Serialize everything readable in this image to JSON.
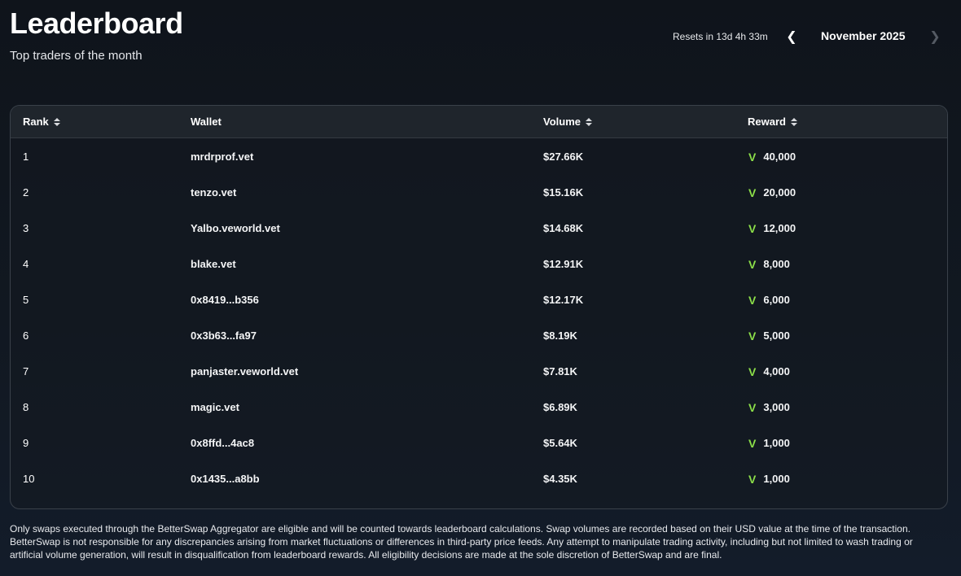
{
  "header": {
    "title": "Leaderboard",
    "subtitle": "Top traders of the month",
    "reset_text": "Resets in 13d 4h 33m",
    "month": "November 2025",
    "prev_icon": "chevron-left-icon",
    "next_icon": "chevron-right-icon"
  },
  "table": {
    "columns": [
      "Rank",
      "Wallet",
      "Volume",
      "Reward"
    ],
    "reward_icon": "vet-token-icon",
    "reward_icon_color": "#8ce049",
    "rows": [
      {
        "rank": "1",
        "wallet": "mrdrprof.vet",
        "volume": "$27.66K",
        "reward": "40,000"
      },
      {
        "rank": "2",
        "wallet": "tenzo.vet",
        "volume": "$15.16K",
        "reward": "20,000"
      },
      {
        "rank": "3",
        "wallet": "Yalbo.veworld.vet",
        "volume": "$14.68K",
        "reward": "12,000"
      },
      {
        "rank": "4",
        "wallet": "blake.vet",
        "volume": "$12.91K",
        "reward": "8,000"
      },
      {
        "rank": "5",
        "wallet": "0x8419...b356",
        "volume": "$12.17K",
        "reward": "6,000"
      },
      {
        "rank": "6",
        "wallet": "0x3b63...fa97",
        "volume": "$8.19K",
        "reward": "5,000"
      },
      {
        "rank": "7",
        "wallet": "panjaster.veworld.vet",
        "volume": "$7.81K",
        "reward": "4,000"
      },
      {
        "rank": "8",
        "wallet": "magic.vet",
        "volume": "$6.89K",
        "reward": "3,000"
      },
      {
        "rank": "9",
        "wallet": "0x8ffd...4ac8",
        "volume": "$5.64K",
        "reward": "1,000"
      },
      {
        "rank": "10",
        "wallet": "0x1435...a8bb",
        "volume": "$4.35K",
        "reward": "1,000"
      }
    ]
  },
  "footer": {
    "disclaimer": "Only swaps executed through the BetterSwap Aggregator are eligible and will be counted towards leaderboard calculations. Swap volumes are recorded based on their USD value at the time of the transaction. BetterSwap is not responsible for any discrepancies arising from market fluctuations or differences in third-party price feeds. Any attempt to manipulate trading activity, including but not limited to wash trading or artificial volume generation, will result in disqualification from leaderboard rewards. All eligibility decisions are made at the sole discretion of BetterSwap and are final."
  }
}
